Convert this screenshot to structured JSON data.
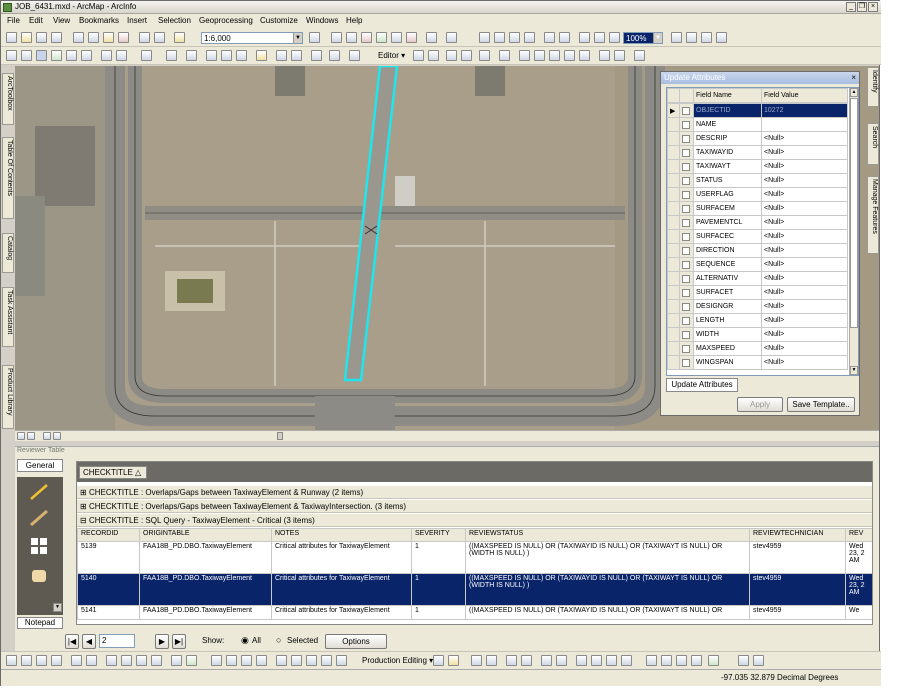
{
  "window": {
    "title": "JOB_6431.mxd - ArcMap - ArcInfo",
    "controls": [
      "_",
      "❐",
      "×"
    ]
  },
  "menu": [
    "File",
    "Edit",
    "View",
    "Bookmarks",
    "Insert",
    "Selection",
    "Geoprocessing",
    "Customize",
    "Windows",
    "Help"
  ],
  "toolbar": {
    "scale": "1:6,000",
    "zoom": "100%",
    "editor_label": "Editor ▾"
  },
  "side_tabs_left": [
    "ArcToolbox",
    "Table Of Contents",
    "Catalog",
    "Task Assistant",
    "Product Library"
  ],
  "side_tabs_right": [
    "Identify",
    "Search",
    "Manage Features"
  ],
  "update_attributes": {
    "title": "Update Attributes",
    "col_field": "Field Name",
    "col_value": "Field Value",
    "rows": [
      {
        "name": "OBJECTID",
        "value": "10272"
      },
      {
        "name": "NAME",
        "value": ""
      },
      {
        "name": "DESCRIP",
        "value": "<Null>"
      },
      {
        "name": "TAXIWAYID",
        "value": "<Null>"
      },
      {
        "name": "TAXIWAYT",
        "value": "<Null>"
      },
      {
        "name": "STATUS",
        "value": "<Null>"
      },
      {
        "name": "USERFLAG",
        "value": "<Null>"
      },
      {
        "name": "SURFACEM",
        "value": "<Null>"
      },
      {
        "name": "PAVEMENTCL",
        "value": "<Null>"
      },
      {
        "name": "SURFACEC",
        "value": "<Null>"
      },
      {
        "name": "DIRECTION",
        "value": "<Null>"
      },
      {
        "name": "SEQUENCE",
        "value": "<Null>"
      },
      {
        "name": "ALTERNATIV",
        "value": "<Null>"
      },
      {
        "name": "SURFACET",
        "value": "<Null>"
      },
      {
        "name": "DESIGNGR",
        "value": "<Null>"
      },
      {
        "name": "LENGTH",
        "value": "<Null>"
      },
      {
        "name": "WIDTH",
        "value": "<Null>"
      },
      {
        "name": "MAXSPEED",
        "value": "<Null>"
      },
      {
        "name": "WINGSPAN",
        "value": "<Null>"
      }
    ],
    "tab_label": "Update Attributes",
    "apply_label": "Apply",
    "save_template_label": "Save Template.."
  },
  "reviewer": {
    "title": "Reviewer Table",
    "general_label": "General",
    "notepad_label": "Notepad",
    "group_by": "CHECKTITLE",
    "groups": [
      "CHECKTITLE : Overlaps/Gaps between TaxiwayElement & Runway (2 items)",
      "CHECKTITLE : Overlaps/Gaps between TaxiwayElement & TaxiwayIntersection. (3 items)",
      "CHECKTITLE : SQL Query - TaxiwayElement - Critical (3 items)"
    ],
    "columns": [
      "RECORDID",
      "ORIGINTABLE",
      "NOTES",
      "SEVERITY",
      "REVIEWSTATUS",
      "REVIEWTECHNICIAN",
      "REV"
    ],
    "rows": [
      {
        "id": "5139",
        "table": "FAA18B_PD.DBO.TaxiwayElement",
        "notes": "Critical attributes for TaxiwayElement",
        "severity": "1",
        "status": "((MAXSPEED IS NULL) OR (TAXIWAYID IS NULL) OR (TAXIWAYT IS NULL) OR (WIDTH IS NULL) )",
        "tech": "stev4959",
        "rev": "Wed 23, 2 AM"
      },
      {
        "id": "5140",
        "table": "FAA18B_PD.DBO.TaxiwayElement",
        "notes": "Critical attributes for TaxiwayElement",
        "severity": "1",
        "status": "((MAXSPEED IS NULL) OR (TAXIWAYID IS NULL) OR (TAXIWAYT IS NULL) OR (WIDTH IS NULL) )",
        "tech": "stev4959",
        "rev": "Wed 23, 2 AM"
      },
      {
        "id": "5141",
        "table": "FAA18B_PD.DBO.TaxiwayElement",
        "notes": "Critical attributes for TaxiwayElement",
        "severity": "1",
        "status": "((MAXSPEED IS NULL) OR (TAXIWAYID IS NULL) OR (TAXIWAYT IS NULL) OR",
        "tech": "stev4959",
        "rev": "We"
      }
    ],
    "record_value": "2",
    "show_label": "Show:",
    "all_label": "All",
    "selected_label": "Selected",
    "options_label": "Options"
  },
  "bottom_toolbar": {
    "production_editing": "Production Editing ▾"
  },
  "status": {
    "coords": "-97.035  32.879 Decimal Degrees"
  }
}
